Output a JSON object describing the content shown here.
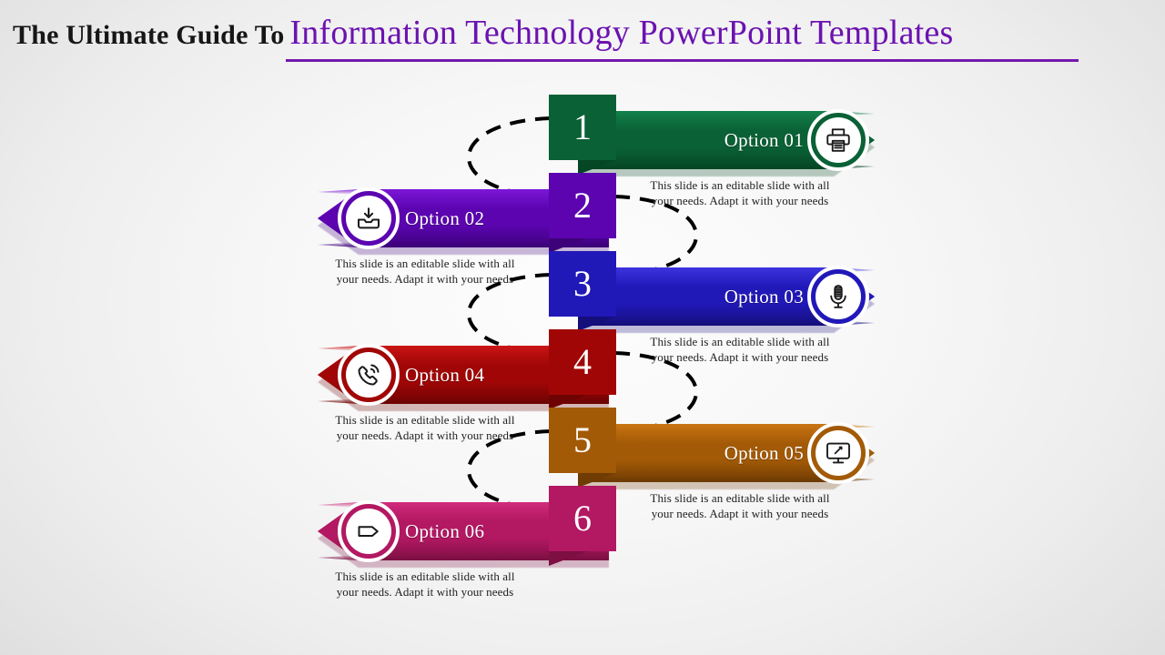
{
  "slide": {
    "title_plain": "The Ultimate Guide To",
    "title_accent": "Information Technology PowerPoint Templates",
    "accent_color": "#6b12b0",
    "rule_color": "#7517ae",
    "background": "#f2f2f2"
  },
  "body_text": "This slide is an editable slide with all your needs. Adapt it with your needs",
  "steps": [
    {
      "number": "1",
      "label": "Option 01",
      "icon": "printer-icon",
      "direction": "right",
      "color": "#0a6135",
      "color_light": "#12804a",
      "color_dark": "#054725",
      "description": "This slide is an editable slide with all your needs. Adapt it with your needs"
    },
    {
      "number": "2",
      "label": "Option 02",
      "icon": "download-inbox-icon",
      "direction": "left",
      "color": "#5b04b0",
      "color_light": "#7a16d6",
      "color_dark": "#3d027a",
      "description": "This slide is an editable slide with all your needs. Adapt it with your needs"
    },
    {
      "number": "3",
      "label": "Option 03",
      "icon": "microphone-icon",
      "direction": "right",
      "color": "#2118b8",
      "color_light": "#3b32dd",
      "color_dark": "#150f7c",
      "description": "This slide is an editable slide with all your needs. Adapt it with your needs"
    },
    {
      "number": "4",
      "label": "Option 04",
      "icon": "phone-call-icon",
      "direction": "left",
      "color": "#a10606",
      "color_light": "#c91414",
      "color_dark": "#6e0303",
      "description": "This slide is an editable slide with all your needs. Adapt it with your needs"
    },
    {
      "number": "5",
      "label": "Option 05",
      "icon": "desktop-monitor-icon",
      "direction": "right",
      "color": "#a35a06",
      "color_light": "#c87412",
      "color_dark": "#6f3c03",
      "description": "This slide is an editable slide with all your needs. Adapt it with your needs"
    },
    {
      "number": "6",
      "label": "Option 06",
      "icon": "tag-label-icon",
      "direction": "left",
      "color": "#b31862",
      "color_light": "#d02b7c",
      "color_dark": "#7d0f43",
      "description": "This slide is an editable slide with all your needs. Adapt it with your needs"
    }
  ]
}
